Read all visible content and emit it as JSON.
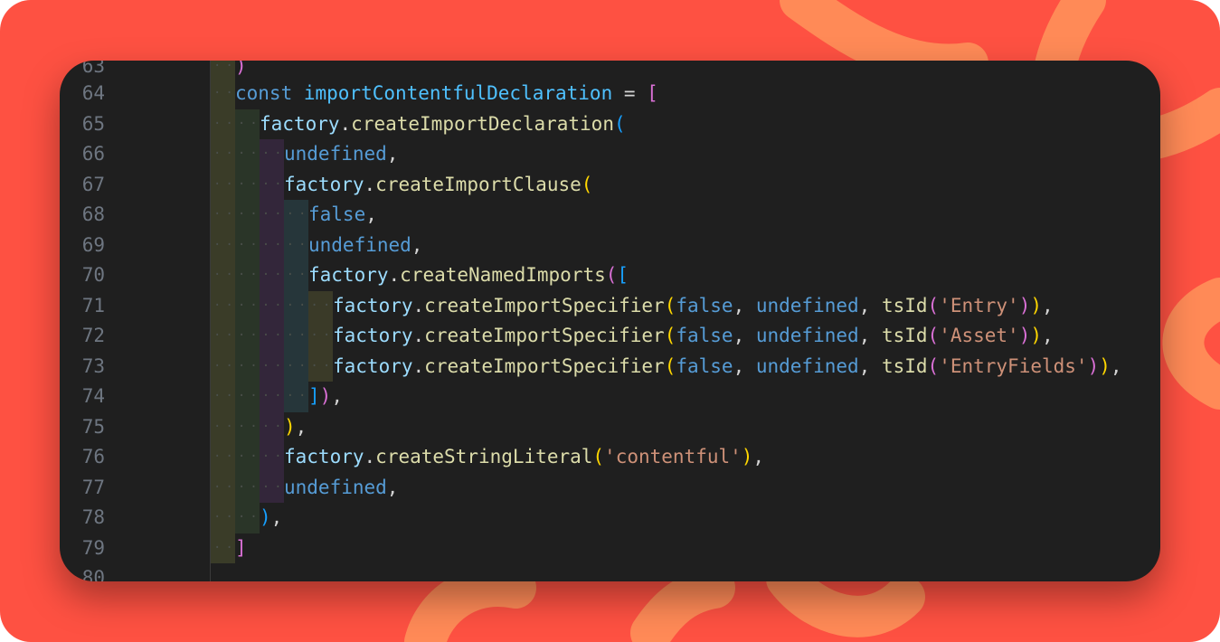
{
  "colors": {
    "background": "#fe5142",
    "decoration": "#ff8a57",
    "editor": "#1f1f1f",
    "line_number": "#6e7681",
    "keyword": "#569cd6",
    "identifier": "#4fc1ff",
    "method": "#dcdcaa",
    "object": "#9cdcfe",
    "string": "#ce9178",
    "bracket_gold": "#ffd700",
    "bracket_pink": "#da70d6",
    "bracket_blue": "#179fff"
  },
  "editor": {
    "partial_top_line_number": "63",
    "partial_top_line_text": ")",
    "partial_bottom_line_number": "80",
    "lines": [
      {
        "n": "64",
        "depth": 1,
        "tokens": [
          [
            "kw",
            "const "
          ],
          [
            "var",
            "importContentfulDeclaration"
          ],
          [
            "pn",
            " = "
          ],
          [
            "b2",
            "["
          ]
        ]
      },
      {
        "n": "65",
        "depth": 2,
        "tokens": [
          [
            "obj",
            "factory"
          ],
          [
            "pn",
            "."
          ],
          [
            "fn",
            "createImportDeclaration"
          ],
          [
            "b3",
            "("
          ]
        ]
      },
      {
        "n": "66",
        "depth": 3,
        "tokens": [
          [
            "lit",
            "undefined"
          ],
          [
            "pn",
            ","
          ]
        ]
      },
      {
        "n": "67",
        "depth": 3,
        "tokens": [
          [
            "obj",
            "factory"
          ],
          [
            "pn",
            "."
          ],
          [
            "fn",
            "createImportClause"
          ],
          [
            "b1",
            "("
          ]
        ]
      },
      {
        "n": "68",
        "depth": 4,
        "tokens": [
          [
            "lit",
            "false"
          ],
          [
            "pn",
            ","
          ]
        ]
      },
      {
        "n": "69",
        "depth": 4,
        "tokens": [
          [
            "lit",
            "undefined"
          ],
          [
            "pn",
            ","
          ]
        ]
      },
      {
        "n": "70",
        "depth": 4,
        "tokens": [
          [
            "obj",
            "factory"
          ],
          [
            "pn",
            "."
          ],
          [
            "fn",
            "createNamedImports"
          ],
          [
            "b2",
            "("
          ],
          [
            "b3",
            "["
          ]
        ]
      },
      {
        "n": "71",
        "depth": 5,
        "tokens": [
          [
            "obj",
            "factory"
          ],
          [
            "pn",
            "."
          ],
          [
            "fn",
            "createImportSpecifier"
          ],
          [
            "b1",
            "("
          ],
          [
            "lit",
            "false"
          ],
          [
            "pn",
            ", "
          ],
          [
            "lit",
            "undefined"
          ],
          [
            "pn",
            ", "
          ],
          [
            "fn",
            "tsId"
          ],
          [
            "b2",
            "("
          ],
          [
            "str",
            "'Entry'"
          ],
          [
            "b2",
            ")"
          ],
          [
            "b1",
            ")"
          ],
          [
            "pn",
            ","
          ]
        ]
      },
      {
        "n": "72",
        "depth": 5,
        "tokens": [
          [
            "obj",
            "factory"
          ],
          [
            "pn",
            "."
          ],
          [
            "fn",
            "createImportSpecifier"
          ],
          [
            "b1",
            "("
          ],
          [
            "lit",
            "false"
          ],
          [
            "pn",
            ", "
          ],
          [
            "lit",
            "undefined"
          ],
          [
            "pn",
            ", "
          ],
          [
            "fn",
            "tsId"
          ],
          [
            "b2",
            "("
          ],
          [
            "str",
            "'Asset'"
          ],
          [
            "b2",
            ")"
          ],
          [
            "b1",
            ")"
          ],
          [
            "pn",
            ","
          ]
        ]
      },
      {
        "n": "73",
        "depth": 5,
        "tokens": [
          [
            "obj",
            "factory"
          ],
          [
            "pn",
            "."
          ],
          [
            "fn",
            "createImportSpecifier"
          ],
          [
            "b1",
            "("
          ],
          [
            "lit",
            "false"
          ],
          [
            "pn",
            ", "
          ],
          [
            "lit",
            "undefined"
          ],
          [
            "pn",
            ", "
          ],
          [
            "fn",
            "tsId"
          ],
          [
            "b2",
            "("
          ],
          [
            "str",
            "'EntryFields'"
          ],
          [
            "b2",
            ")"
          ],
          [
            "b1",
            ")"
          ],
          [
            "pn",
            ","
          ]
        ]
      },
      {
        "n": "74",
        "depth": 4,
        "tokens": [
          [
            "b3",
            "]"
          ],
          [
            "b2",
            ")"
          ],
          [
            "pn",
            ","
          ]
        ]
      },
      {
        "n": "75",
        "depth": 3,
        "tokens": [
          [
            "b1",
            ")"
          ],
          [
            "pn",
            ","
          ]
        ]
      },
      {
        "n": "76",
        "depth": 3,
        "tokens": [
          [
            "obj",
            "factory"
          ],
          [
            "pn",
            "."
          ],
          [
            "fn",
            "createStringLiteral"
          ],
          [
            "b1",
            "("
          ],
          [
            "str",
            "'contentful'"
          ],
          [
            "b1",
            ")"
          ],
          [
            "pn",
            ","
          ]
        ]
      },
      {
        "n": "77",
        "depth": 3,
        "tokens": [
          [
            "lit",
            "undefined"
          ],
          [
            "pn",
            ","
          ]
        ]
      },
      {
        "n": "78",
        "depth": 2,
        "tokens": [
          [
            "b3",
            ")"
          ],
          [
            "pn",
            ","
          ]
        ]
      },
      {
        "n": "79",
        "depth": 1,
        "tokens": [
          [
            "b2",
            "]"
          ]
        ]
      }
    ]
  }
}
